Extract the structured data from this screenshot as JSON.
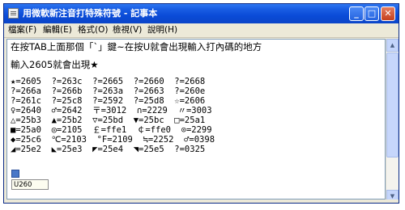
{
  "window": {
    "title": "用微軟新注音打特殊符號 - 記事本",
    "controls": {
      "minimize": "_",
      "maximize": "□",
      "close": "✕"
    }
  },
  "menu": [
    "檔案(F)",
    "編輯(E)",
    "格式(O)",
    "檢視(V)",
    "說明(H)"
  ],
  "document": {
    "lines": [
      "在按TAB上面那個「`」鍵~在按U就會出現輸入打內碼的地方",
      "輸入2605就會出現★",
      "★=2605  ?=263c  ?=2665  ?=2660  ?=2668",
      "?=266a  ?=266b  ?=263a  ?=2663  ?=260e",
      "?=261c  ?=25c8  ?=2592  ?=25d8  ☆=2606",
      "♀=2640  ♂=2642  〒=3012  ∩=2229  〃=3003",
      "△=25b3  ▲=25b2  ▽=25bd  ▼=25bc  □=25a1",
      "■=25a0  ◎=2105  ￡=ffe1  ￠=ffe0  ⊙=2299",
      "◆=25c6  ℃=2103  °F=2109  ≒=2252  ♂=0398",
      "◢=25e2  ◣=25e3  ◤=25e4  ◥=25e5  ?=0325"
    ],
    "ime_hint": "U260"
  },
  "icons": {
    "app": "notepad-icon"
  }
}
